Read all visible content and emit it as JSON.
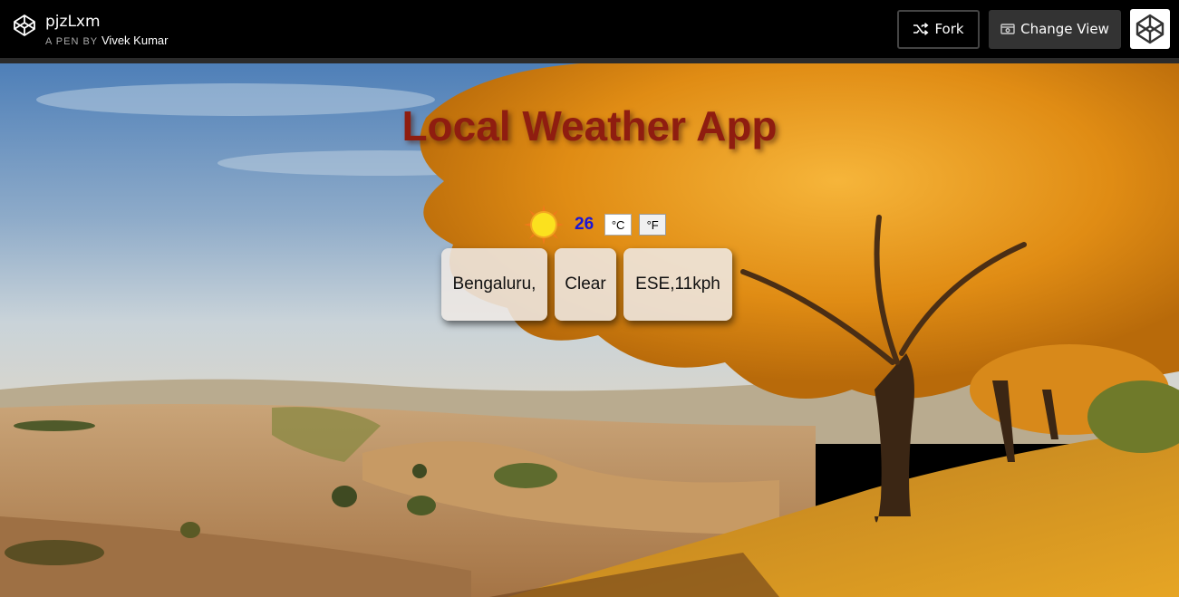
{
  "header": {
    "pen_title": "pjzLxm",
    "pen_by_label": "A PEN BY",
    "author": "Vivek Kumar",
    "fork_label": "Fork",
    "change_view_label": "Change View"
  },
  "app": {
    "title": "Local Weather App",
    "temperature": "26",
    "unit_celsius": "°C",
    "unit_fahrenheit": "°F",
    "location": "Bengaluru,",
    "condition": "Clear",
    "wind": "ESE,11kph",
    "weather_icon": "sun-icon"
  },
  "colors": {
    "topbar": "#000000",
    "title": "#8f1d10",
    "temperature": "#1a16d6",
    "card": "#eee8e4"
  }
}
